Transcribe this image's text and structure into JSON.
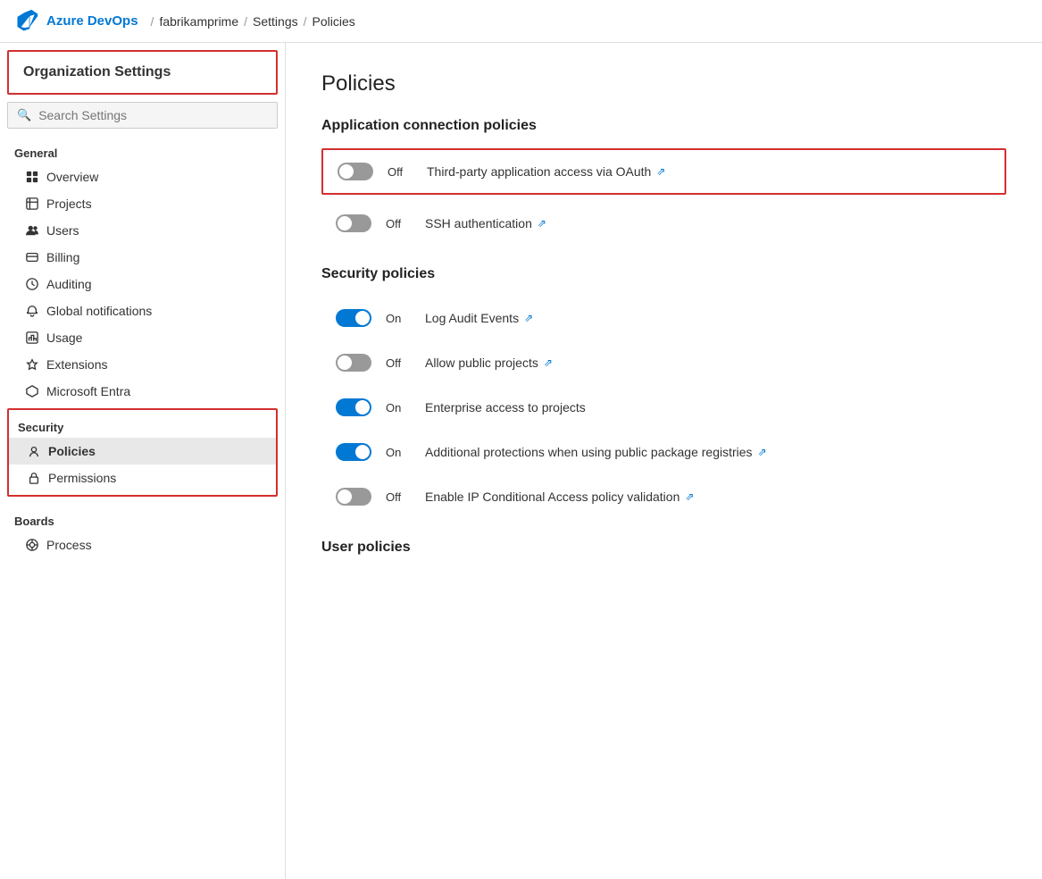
{
  "topnav": {
    "brand": "Azure DevOps",
    "org": "fabrikamprime",
    "sep1": "/",
    "settings": "Settings",
    "sep2": "/",
    "current": "Policies"
  },
  "sidebar": {
    "org_settings_label": "Organization Settings",
    "search_placeholder": "Search Settings",
    "general_label": "General",
    "general_items": [
      {
        "id": "overview",
        "label": "Overview",
        "icon": "grid"
      },
      {
        "id": "projects",
        "label": "Projects",
        "icon": "projects"
      },
      {
        "id": "users",
        "label": "Users",
        "icon": "users"
      },
      {
        "id": "billing",
        "label": "Billing",
        "icon": "billing"
      },
      {
        "id": "auditing",
        "label": "Auditing",
        "icon": "auditing"
      },
      {
        "id": "global-notifications",
        "label": "Global notifications",
        "icon": "bell"
      },
      {
        "id": "usage",
        "label": "Usage",
        "icon": "usage"
      },
      {
        "id": "extensions",
        "label": "Extensions",
        "icon": "extensions"
      },
      {
        "id": "microsoft-entra",
        "label": "Microsoft Entra",
        "icon": "entra"
      }
    ],
    "security_label": "Security",
    "security_items": [
      {
        "id": "policies",
        "label": "Policies",
        "icon": "policy",
        "active": true
      },
      {
        "id": "permissions",
        "label": "Permissions",
        "icon": "lock"
      }
    ],
    "boards_label": "Boards",
    "boards_items": [
      {
        "id": "process",
        "label": "Process",
        "icon": "process"
      }
    ]
  },
  "main": {
    "page_title": "Policies",
    "app_connection_section": "Application connection policies",
    "app_connection_policies": [
      {
        "id": "oauth",
        "state": "off",
        "state_label": "Off",
        "label": "Third-party application access via OAuth",
        "highlighted": true
      },
      {
        "id": "ssh",
        "state": "off",
        "state_label": "Off",
        "label": "SSH authentication",
        "highlighted": false
      }
    ],
    "security_section": "Security policies",
    "security_policies": [
      {
        "id": "log-audit",
        "state": "on",
        "state_label": "On",
        "label": "Log Audit Events",
        "highlighted": false
      },
      {
        "id": "public-projects",
        "state": "off",
        "state_label": "Off",
        "label": "Allow public projects",
        "highlighted": false
      },
      {
        "id": "enterprise-access",
        "state": "on",
        "state_label": "On",
        "label": "Enterprise access to projects",
        "highlighted": false
      },
      {
        "id": "package-registries",
        "state": "on",
        "state_label": "On",
        "label": "Additional protections when using public package registries",
        "highlighted": false
      },
      {
        "id": "ip-conditional",
        "state": "off",
        "state_label": "Off",
        "label": "Enable IP Conditional Access policy validation",
        "highlighted": false
      }
    ],
    "user_policies_section": "User policies"
  },
  "icons": {
    "search": "🔍",
    "link": "⇗"
  }
}
